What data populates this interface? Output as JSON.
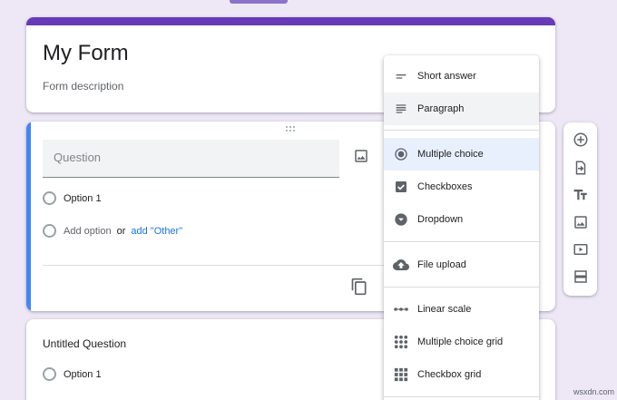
{
  "form": {
    "title": "My Form",
    "description": "Form description"
  },
  "question": {
    "placeholder": "Question",
    "option_1": "Option 1",
    "add_option": "Add option",
    "or": "or",
    "add_other": "add \"Other\""
  },
  "untitled": {
    "title": "Untitled Question",
    "option_1": "Option 1"
  },
  "menu": {
    "items": [
      {
        "label": "Short answer",
        "icon": "short-answer-icon"
      },
      {
        "label": "Paragraph",
        "icon": "paragraph-icon",
        "state": "hovered"
      },
      {
        "label": "Multiple choice",
        "icon": "radio-checked-icon",
        "state": "selected"
      },
      {
        "label": "Checkboxes",
        "icon": "checkbox-icon"
      },
      {
        "label": "Dropdown",
        "icon": "dropdown-icon"
      },
      {
        "label": "File upload",
        "icon": "cloud-upload-icon"
      },
      {
        "label": "Linear scale",
        "icon": "linear-scale-icon"
      },
      {
        "label": "Multiple choice grid",
        "icon": "grid-icon"
      },
      {
        "label": "Checkbox grid",
        "icon": "grid-icon"
      }
    ]
  },
  "toolbar": {
    "icons": [
      "add-question-icon",
      "import-questions-icon",
      "add-title-icon",
      "add-image-icon",
      "add-video-icon",
      "add-section-icon"
    ]
  },
  "watermark": "wsxdn.com",
  "colors": {
    "background": "#ede7f6",
    "theme": "#673ab7",
    "active_bar": "#4285f4",
    "link": "#1a73e8"
  }
}
